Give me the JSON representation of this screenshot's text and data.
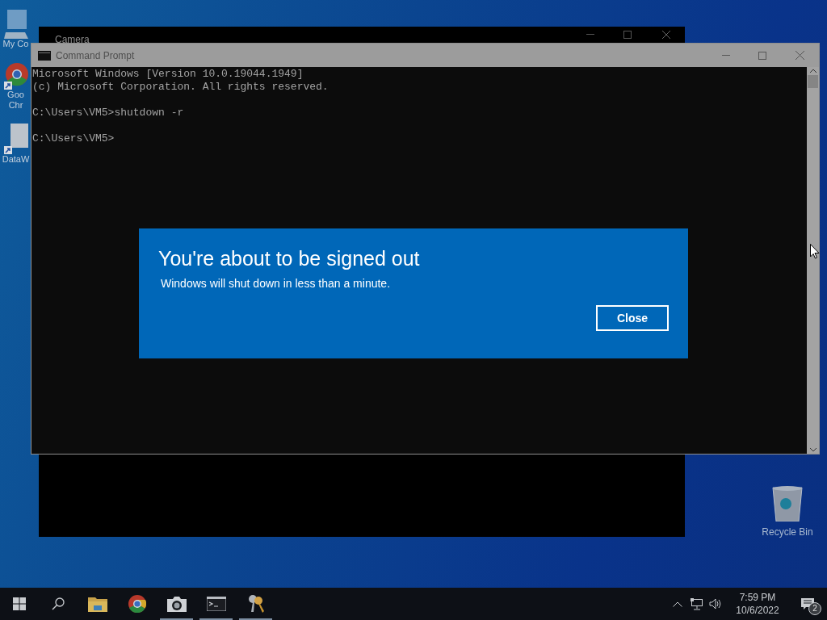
{
  "desktop_icons": [
    {
      "kind": "computer",
      "label_lines": [
        "My Co"
      ]
    },
    {
      "kind": "chrome",
      "label_lines": [
        "Goo",
        "Chr"
      ]
    },
    {
      "kind": "file",
      "label_lines": [
        "DataW"
      ]
    }
  ],
  "recycle_bin": {
    "label": "Recycle Bin"
  },
  "camera_window": {
    "title": "Camera"
  },
  "cmd_window": {
    "title": "Command Prompt",
    "blocks": [
      [
        "Microsoft Windows [Version 10.0.19044.1949]",
        "(c) Microsoft Corporation. All rights reserved."
      ],
      [
        "C:\\Users\\VM5>shutdown -r"
      ],
      [
        "C:\\Users\\VM5>"
      ]
    ]
  },
  "dialog": {
    "title": "You're about to be signed out",
    "message": "Windows will shut down in less than a minute.",
    "button": "Close"
  },
  "taskbar": {
    "apps": [
      {
        "kind": "explorer",
        "running": false
      },
      {
        "kind": "chrome",
        "running": false
      },
      {
        "kind": "camera",
        "running": true
      },
      {
        "kind": "terminal",
        "running": true
      },
      {
        "kind": "keys",
        "running": true
      }
    ],
    "tray": {
      "time": "7:59 PM",
      "date": "10/6/2022",
      "notification_count": "2"
    }
  }
}
